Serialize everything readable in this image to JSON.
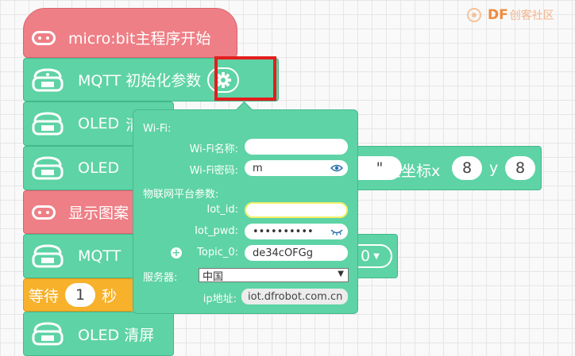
{
  "watermark": {
    "brand": "DF",
    "site": "创客社区"
  },
  "blocks": {
    "start": "micro:bit主程序开始",
    "mqtt_init": "MQTT 初始化参数",
    "oled1_prefix": "OLED",
    "oled1_suffix": "清",
    "oled2_prefix": "OLED",
    "oled2_quote": "\"",
    "oled2_at": "在坐标x",
    "oled2_x": "8",
    "oled2_y_label": "y",
    "oled2_y": "8",
    "show_pattern": "显示图案",
    "mqtt2_prefix": "MQTT",
    "mqtt2_value": "0",
    "wait_label": "等待",
    "wait_value": "1",
    "wait_unit": "秒",
    "oled_clear": "OLED 清屏"
  },
  "popup": {
    "wifi_header": "Wi-Fi:",
    "wifi_name_label": "Wi-Fi名称:",
    "wifi_name_value": "",
    "wifi_pwd_label": "Wi-Fi密码:",
    "wifi_pwd_value": "m",
    "iot_header": "物联网平台参数:",
    "iot_id_label": "Iot_id:",
    "iot_id_value": "",
    "iot_pwd_label": "Iot_pwd:",
    "iot_pwd_value": "••••••••••",
    "topic_label": "Topic_0:",
    "topic_value": "de34cOFGg",
    "server_label": "服务器:",
    "server_value": "中国",
    "ip_label": "ip地址:",
    "ip_value": "iot.dfrobot.com.cn"
  },
  "colors": {
    "green": "#5ed3a5",
    "red": "#ee7f86",
    "orange": "#f7b12b",
    "highlight": "#e41d1d"
  }
}
